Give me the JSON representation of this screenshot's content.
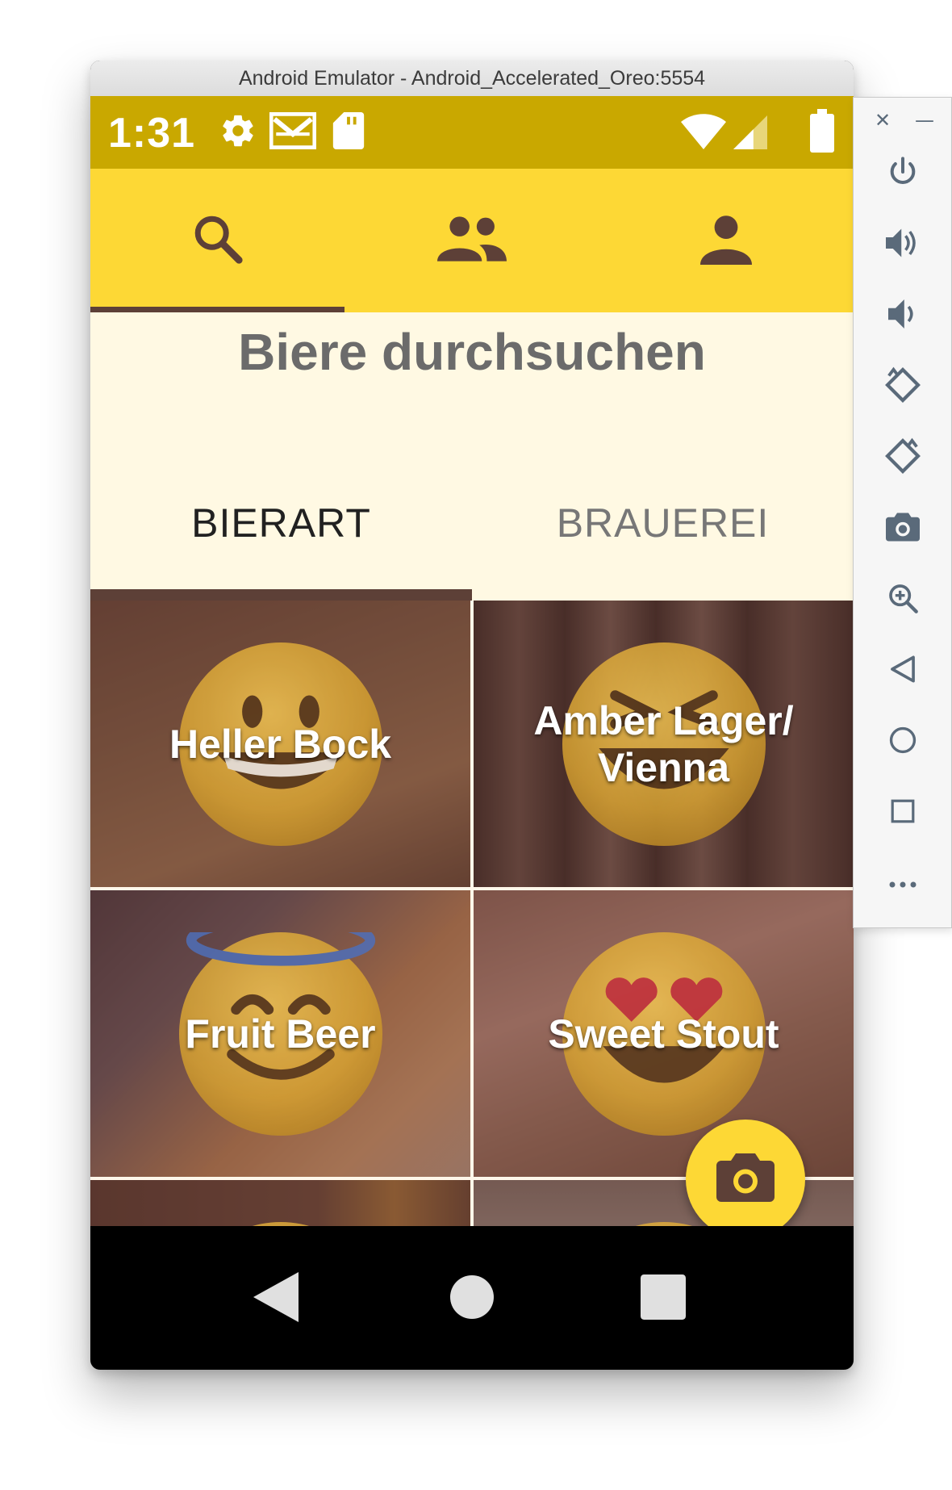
{
  "window": {
    "title": "Android Emulator - Android_Accelerated_Oreo:5554"
  },
  "status_bar": {
    "time": "1:31",
    "icons": [
      "settings-icon",
      "gmail-icon",
      "sd-card-icon",
      "wifi-icon",
      "signal-icon",
      "battery-icon"
    ]
  },
  "top_tabs": [
    {
      "icon": "search-icon",
      "active": true
    },
    {
      "icon": "group-icon",
      "active": false
    },
    {
      "icon": "person-icon",
      "active": false
    }
  ],
  "page": {
    "title": "Biere durchsuchen"
  },
  "sub_tabs": {
    "bierart": "BIERART",
    "brauerei": "BRAUEREI",
    "active": "BIERART"
  },
  "tiles": [
    {
      "label": "Heller Bock",
      "emoji": "grinning-face"
    },
    {
      "label": "Amber Lager/ Vienna",
      "emoji": "grinning-squinting-face"
    },
    {
      "label": "Fruit Beer",
      "emoji": "smiling-face-with-halo"
    },
    {
      "label": "Sweet Stout",
      "emoji": "smiling-face-with-heart-eyes"
    }
  ],
  "fab": {
    "icon": "camera-icon"
  },
  "nav_bar": {
    "buttons": [
      "back",
      "home",
      "recents"
    ]
  },
  "emulator_panel": {
    "window_controls": [
      "close",
      "minimize"
    ],
    "buttons": [
      "power",
      "volume-up",
      "volume-down",
      "rotate-left",
      "rotate-right",
      "screenshot",
      "zoom",
      "back",
      "home",
      "overview",
      "more"
    ]
  },
  "colors": {
    "primary": "#fdd835",
    "status_bar": "#c9a800",
    "accent_brown": "#5d4037",
    "background": "#fff9e3"
  }
}
